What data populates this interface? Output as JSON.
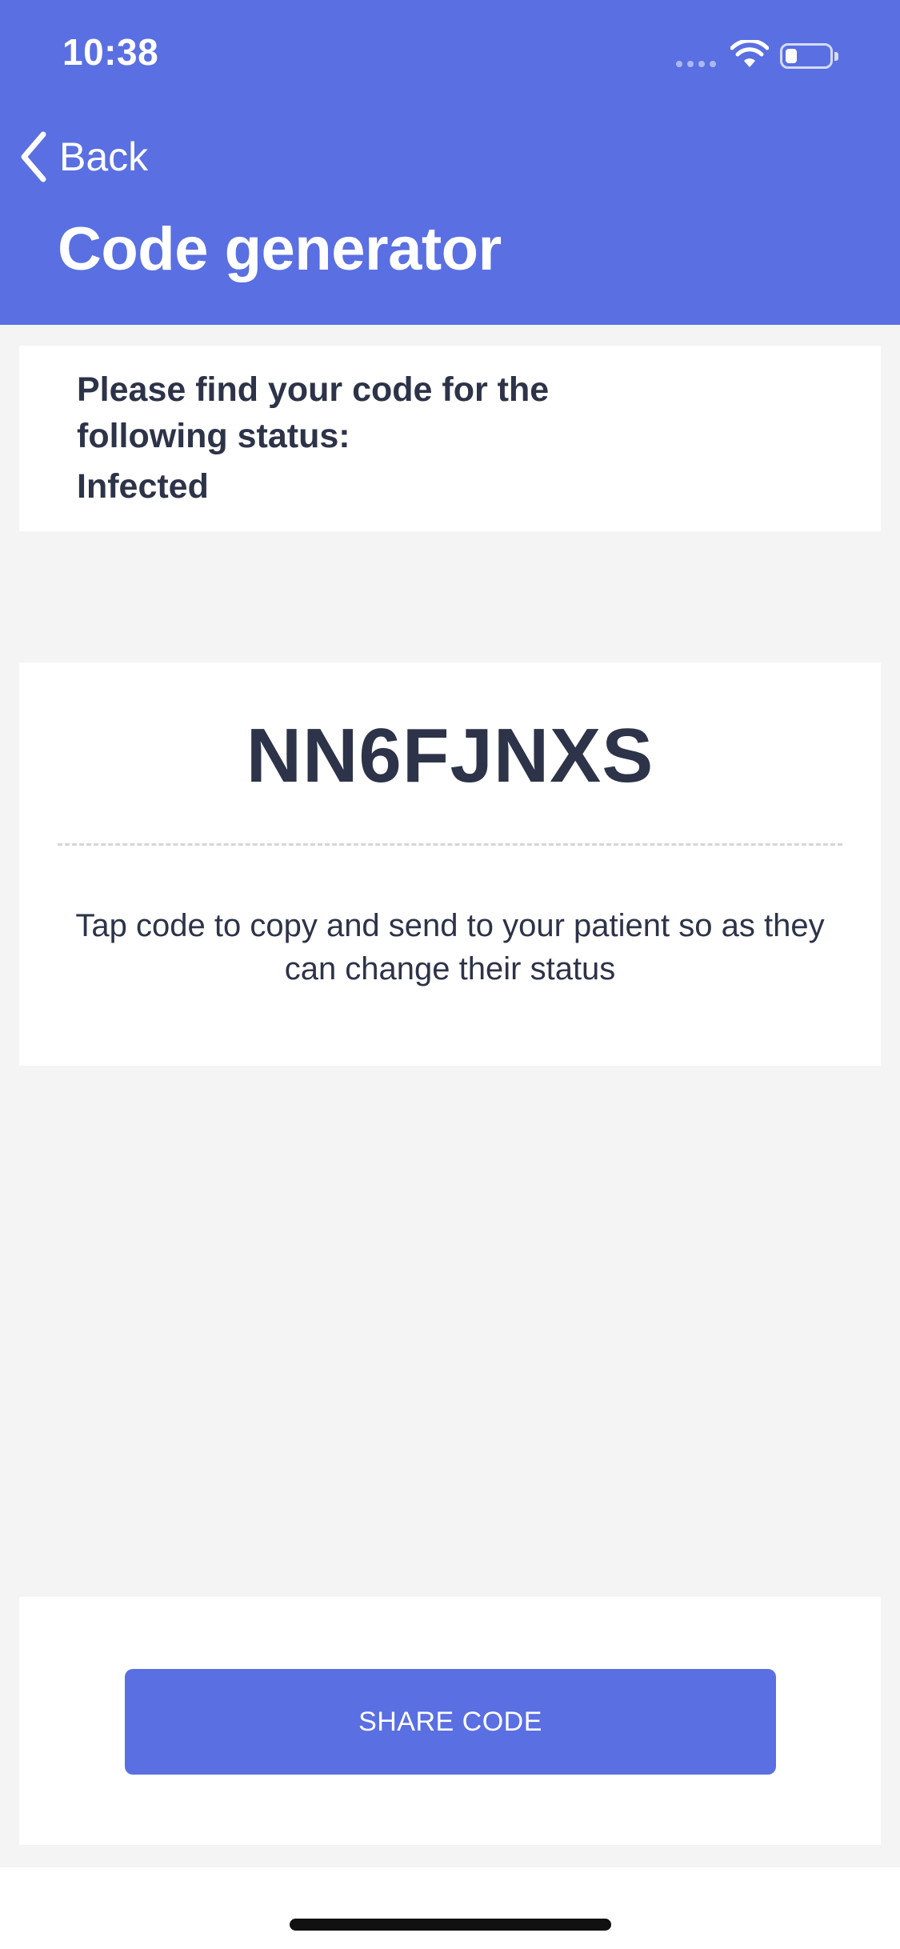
{
  "status_bar": {
    "time": "10:38",
    "icons": [
      "signal-icon",
      "wifi-icon",
      "battery-icon"
    ]
  },
  "nav": {
    "back_label": "Back",
    "title": "Code generator"
  },
  "status_card": {
    "prompt": "Please find your code for the following status:",
    "status": "Infected"
  },
  "code_card": {
    "code": "NN6FJNXS",
    "hint": "Tap code to copy and send to your patient so as they can change their status"
  },
  "actions": {
    "share_label": "SHARE CODE"
  },
  "colors": {
    "accent": "#5a6fe2",
    "background": "#f4f4f4",
    "text": "#2d3348",
    "card": "#ffffff"
  }
}
